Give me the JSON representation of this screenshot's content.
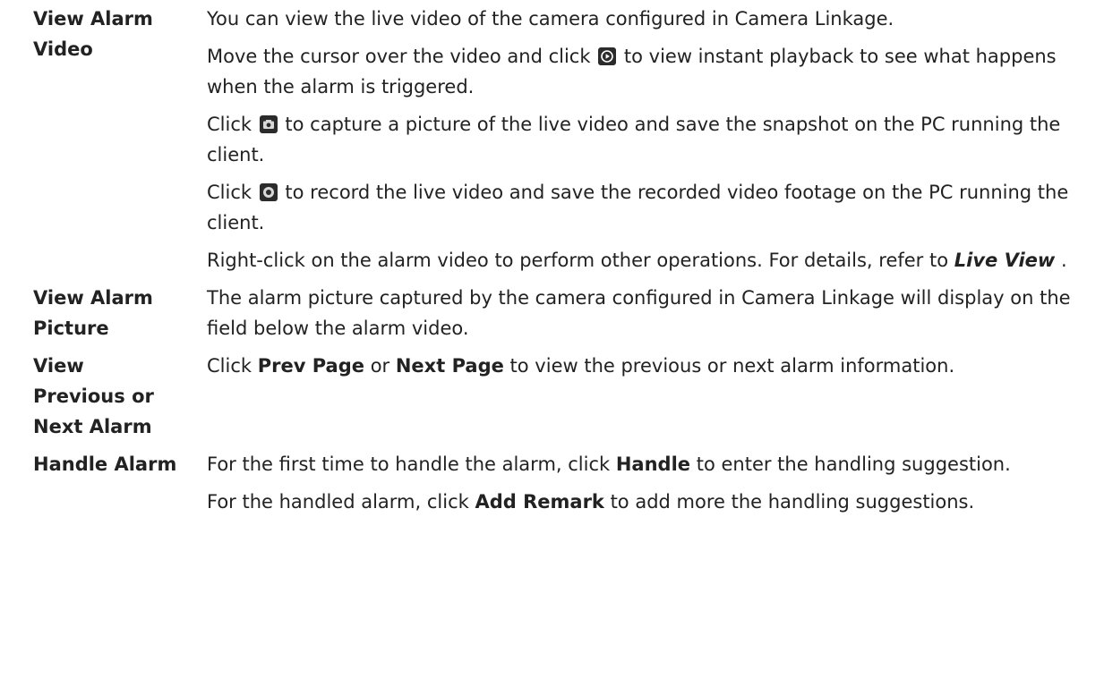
{
  "rows": [
    {
      "term": "View Alarm Video",
      "p1": "You can view the live video of the camera configured in Camera Linkage.",
      "p2a": "Move the cursor over the video and click",
      "p2b": "to view instant playback to see what happens when the alarm is triggered.",
      "p3a": "Click",
      "p3b": "to capture a picture of the live video and save the snapshot on the PC running the client.",
      "p4a": "Click",
      "p4b": "to record the live video and save the recorded video footage on the PC running the client.",
      "p5a": "Right-click on the alarm video to perform other operations. For details, refer to",
      "p5ref": "Live View",
      "p5c": " ."
    },
    {
      "term": "View Alarm Picture",
      "p1": "The alarm picture captured by the camera configured in Camera Linkage will display on the field below the alarm video."
    },
    {
      "term": "View Previous or Next Alarm",
      "p1a": "Click",
      "b1": "Prev Page",
      "p1b": "or",
      "b2": "Next Page",
      "p1c": "to view the previous or next alarm information."
    },
    {
      "term": "Handle Alarm",
      "p1a": "For the first time to handle the alarm, click",
      "b1": "Handle",
      "p1b": "to enter the handling suggestion.",
      "p2a": "For the handled alarm, click",
      "b2": "Add Remark",
      "p2b": "to add more the handling suggestions."
    }
  ],
  "icons": {
    "playback": "instant-playback-icon",
    "capture": "camera-capture-icon",
    "record": "record-icon"
  }
}
